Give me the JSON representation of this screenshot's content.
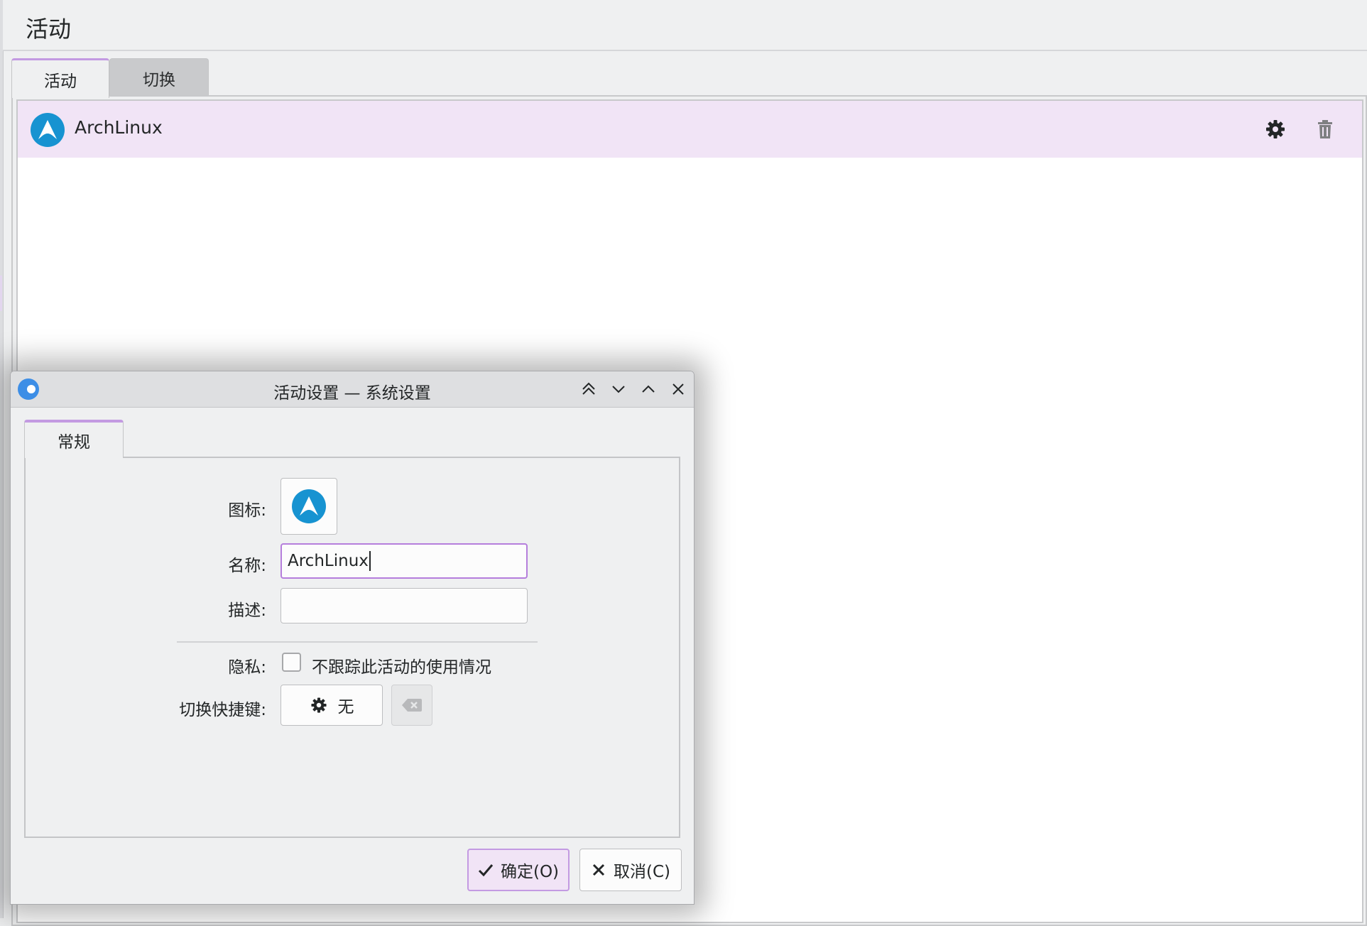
{
  "page": {
    "title": "活动"
  },
  "tabs": [
    {
      "label": "活动",
      "active": true
    },
    {
      "label": "切换",
      "active": false
    }
  ],
  "activities": [
    {
      "name": "ArchLinux",
      "icon": "archlinux-logo"
    }
  ],
  "row_actions": {
    "configure_icon": "gear-icon",
    "delete_icon": "trash-icon"
  },
  "dialog": {
    "title": "活动设置 — 系统设置",
    "window_buttons": [
      "keep-above-icon",
      "minimize-icon",
      "maximize-icon",
      "close-icon"
    ],
    "tab": "常规",
    "fields": {
      "icon_label": "图标:",
      "name_label": "名称:",
      "name_value": "ArchLinux",
      "description_label": "描述:",
      "description_value": "",
      "privacy_label": "隐私:",
      "privacy_checkbox_label": "不跟踪此活动的使用情况",
      "privacy_checked": false,
      "shortcut_label": "切换快捷键:",
      "shortcut_value": "无"
    },
    "buttons": {
      "ok": "确定(O)",
      "cancel": "取消(C)"
    }
  },
  "colors": {
    "accent": "#c39ae2",
    "selection_bg": "#f1e4f6",
    "arch_blue": "#1793d1"
  }
}
